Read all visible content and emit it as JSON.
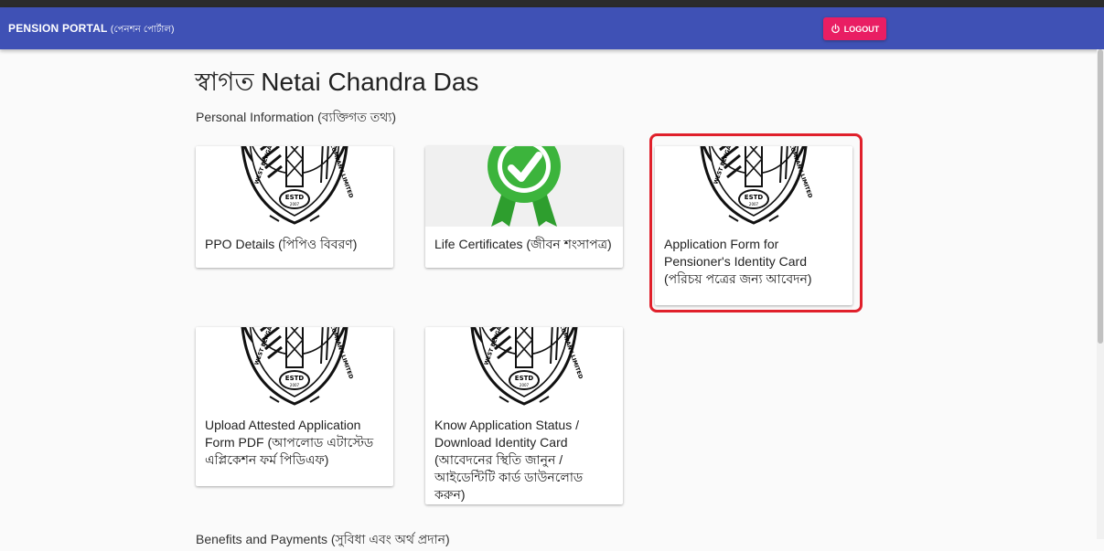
{
  "header": {
    "app_title": "PENSION PORTAL",
    "app_subtitle": "(পেনশন পোর্টাল)",
    "logout_label": "LOGOUT",
    "logout_icon": "power-icon",
    "colors": {
      "appbar": "#3f51b5",
      "logout": "#e91e63"
    }
  },
  "main": {
    "welcome": "স্বাগত Netai Chandra Das",
    "sections": [
      {
        "title": "Personal Information (ব্যক্তিগত তথ্য)"
      },
      {
        "title": "Benefits and Payments (সুবিধা এবং অর্থ প্রদান)"
      }
    ],
    "cards": [
      {
        "label": "PPO Details (পিপিও বিবরণ)",
        "media": "company-seal-logo"
      },
      {
        "label": "Life Certificates (জীবন শংসাপত্র)",
        "media": "green-check-badge-icon"
      },
      {
        "label": "Application Form for Pensioner's Identity Card (পরিচয় পত্রের জন্য আবেদন)",
        "media": "company-seal-logo"
      },
      {
        "label": "Upload Attested Application Form PDF (আপলোড এটাস্টেড এপ্লিকেশন ফর্ম পিডিএফ)",
        "media": "company-seal-logo"
      },
      {
        "label": "Know Application Status / Download Identity Card (আবেদনের স্থিতি জানুন / আইডেন্টিটি কার্ড ডাউনলোড করুন)",
        "media": "company-seal-logo"
      }
    ],
    "seal_text": {
      "estd": "ESTD",
      "year": "2007",
      "left_arc": "WEST BENGAL STATE",
      "right_arc": "COMPANY LIMITED"
    },
    "highlight_color": "#e0202b"
  }
}
